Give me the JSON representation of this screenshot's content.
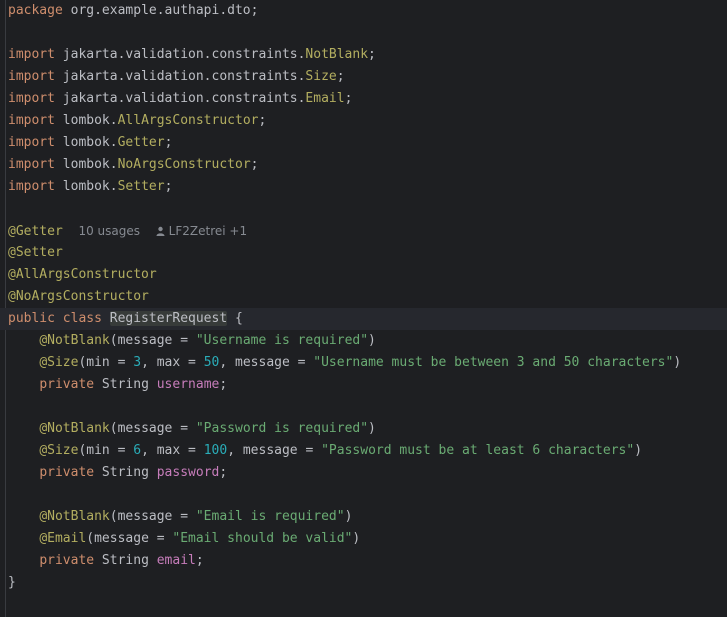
{
  "code": {
    "pkg_kw": "package",
    "pkg_name": " org.example.authapi.dto;",
    "imports": [
      {
        "kw": "import",
        "path": " jakarta.validation.constraints.",
        "name": "NotBlank"
      },
      {
        "kw": "import",
        "path": " jakarta.validation.constraints.",
        "name": "Size"
      },
      {
        "kw": "import",
        "path": " jakarta.validation.constraints.",
        "name": "Email"
      },
      {
        "kw": "import",
        "path": " lombok.",
        "name": "AllArgsConstructor"
      },
      {
        "kw": "import",
        "path": " lombok.",
        "name": "Getter"
      },
      {
        "kw": "import",
        "path": " lombok.",
        "name": "NoArgsConstructor"
      },
      {
        "kw": "import",
        "path": " lombok.",
        "name": "Setter"
      }
    ],
    "semi": ";",
    "ann_getter": "@Getter",
    "usages": "10 usages",
    "author": "LF2Zetrei +1",
    "ann_setter": "@Setter",
    "ann_allargs": "@AllArgsConstructor",
    "ann_noargs": "@NoArgsConstructor",
    "class_kw": "public class",
    "class_name": "RegisterRequest",
    "brace_open": " {",
    "brace_close": "}",
    "f1": {
      "ann1": "@NotBlank",
      "ann1_args_a": "(message = ",
      "ann1_str": "\"Username is required\"",
      "close": ")",
      "ann2": "@Size",
      "a_min": "(min = ",
      "min": "3",
      "a_max": ", max = ",
      "max": "50",
      "a_msg": ", message = ",
      "ann2_str": "\"Username must be between 3 and 50 characters\"",
      "mod": "private",
      "type": " String ",
      "name": "username"
    },
    "f2": {
      "ann1": "@NotBlank",
      "ann1_args_a": "(message = ",
      "ann1_str": "\"Password is required\"",
      "close": ")",
      "ann2": "@Size",
      "a_min": "(min = ",
      "min": "6",
      "a_max": ", max = ",
      "max": "100",
      "a_msg": ", message = ",
      "ann2_str": "\"Password must be at least 6 characters\"",
      "mod": "private",
      "type": " String ",
      "name": "password"
    },
    "f3": {
      "ann1": "@NotBlank",
      "ann1_args_a": "(message = ",
      "ann1_str": "\"Email is required\"",
      "close": ")",
      "ann2": "@Email",
      "ann2_args_a": "(message = ",
      "ann2_str": "\"Email should be valid\"",
      "mod": "private",
      "type": " String ",
      "name": "email"
    }
  },
  "colors": {
    "background": "#1e1f22",
    "keyword": "#cf8e6d",
    "annotation": "#b3ae60",
    "string": "#6aab73",
    "number": "#2aacb8",
    "field": "#c77dbb"
  }
}
